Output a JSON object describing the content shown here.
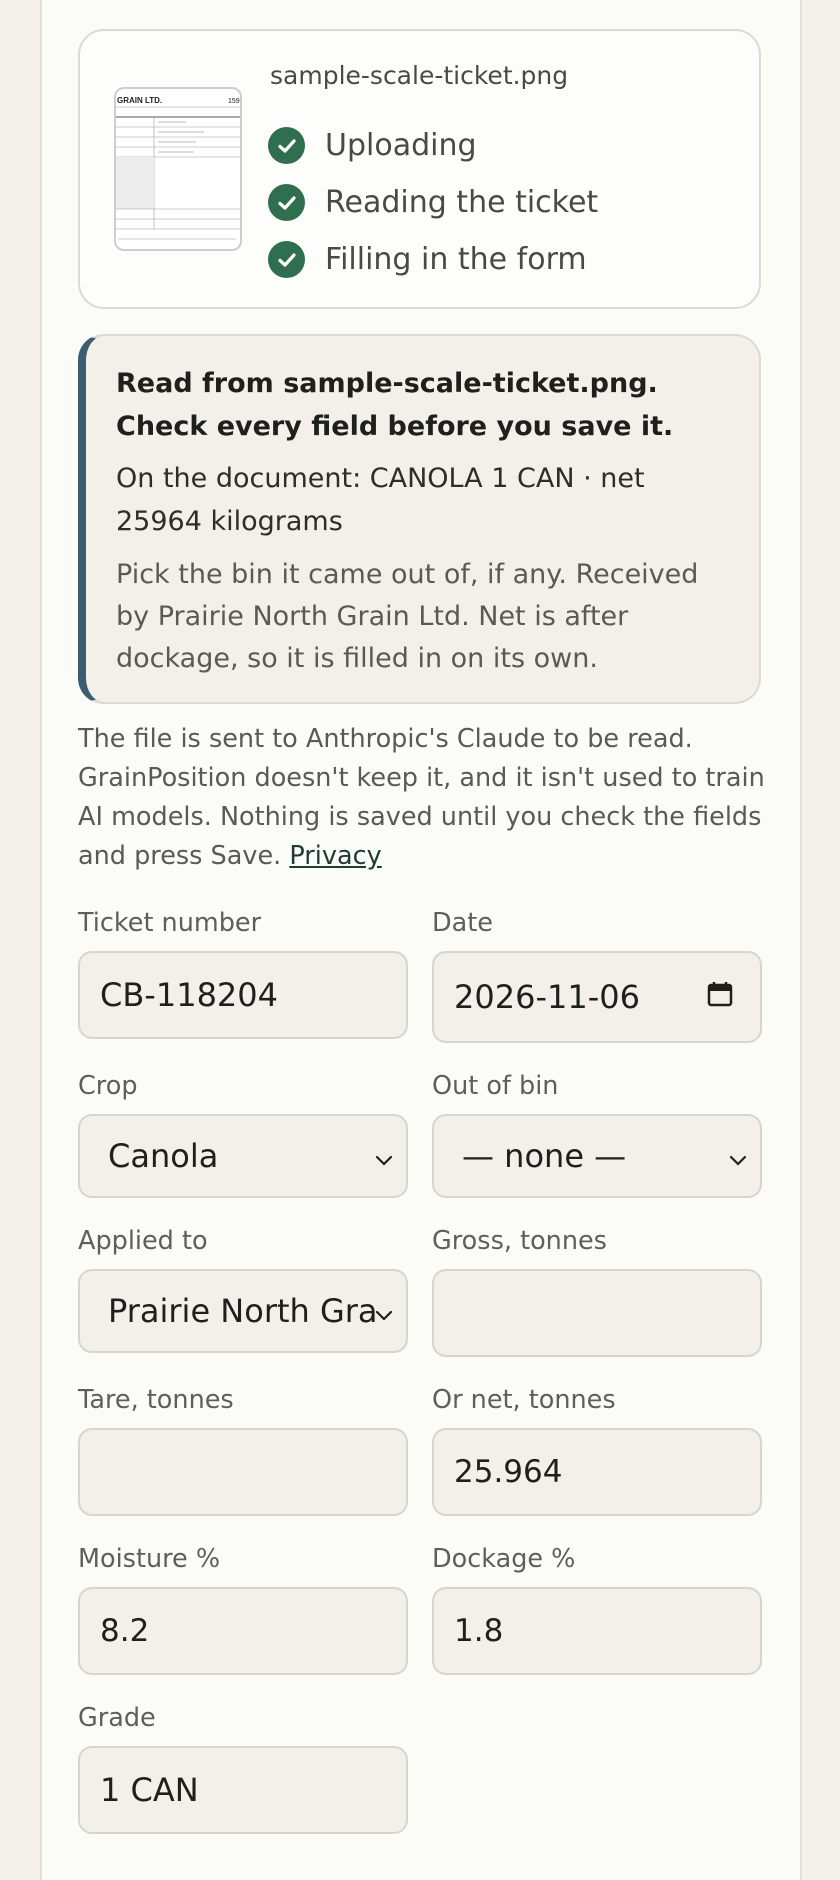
{
  "upload": {
    "filename": "sample-scale-ticket.png",
    "steps": [
      {
        "label": "Uploading",
        "status": "done"
      },
      {
        "label": "Reading the ticket",
        "status": "done"
      },
      {
        "label": "Filling in the form",
        "status": "done"
      }
    ],
    "thumbnail": {
      "header": "GRAIN LTD.",
      "number": "159"
    }
  },
  "notice": {
    "title": "Read from sample-scale-ticket.png. Check every field before you save it.",
    "document_line": "On the document: CANOLA 1 CAN · net 25964 kilograms",
    "hint": "Pick the bin it came out of, if any. Received by Prairie North Grain Ltd. Net is after dockage, so it is filled in on its own."
  },
  "privacy": {
    "text": "The file is sent to Anthropic's Claude to be read. GrainPosition doesn't keep it, and it isn't used to train AI models. Nothing is saved until you check the fields and press Save.",
    "link": "Privacy"
  },
  "form": {
    "ticket_number": {
      "label": "Ticket number",
      "value": "CB-118204"
    },
    "date": {
      "label": "Date",
      "value": "2026-11-06"
    },
    "crop": {
      "label": "Crop",
      "value": "Canola"
    },
    "out_of_bin": {
      "label": "Out of bin",
      "value": "— none —"
    },
    "applied_to": {
      "label": "Applied to",
      "value": "Prairie North Gra"
    },
    "gross": {
      "label": "Gross, tonnes",
      "value": ""
    },
    "tare": {
      "label": "Tare, tonnes",
      "value": ""
    },
    "net": {
      "label": "Or net, tonnes",
      "value": "25.964"
    },
    "moisture": {
      "label": "Moisture %",
      "value": "8.2"
    },
    "dockage": {
      "label": "Dockage %",
      "value": "1.8"
    },
    "grade": {
      "label": "Grade",
      "value": "1 CAN"
    }
  },
  "colors": {
    "accent": "#2f6f4f",
    "notice_bar": "#3a5e6d",
    "field_bg": "#f2f0e8"
  }
}
